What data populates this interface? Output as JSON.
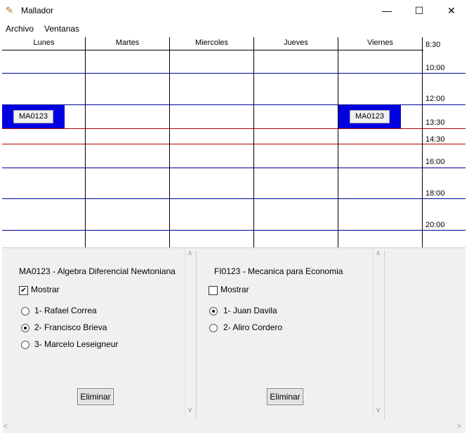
{
  "window": {
    "title": "Mallador",
    "icon": "compass-icon",
    "minimize": "—",
    "maximize": "☐",
    "close": "✕"
  },
  "menu": {
    "items": [
      "Archivo",
      "Ventanas"
    ]
  },
  "schedule": {
    "days": [
      "Lunes",
      "Martes",
      "Miercoles",
      "Jueves",
      "Viernes"
    ],
    "times": [
      "8:30",
      "10:00",
      "12:00",
      "13:30",
      "14:30",
      "16:00",
      "18:00",
      "20:00"
    ],
    "blocks": [
      {
        "day": "Lunes",
        "label": "MA0123"
      },
      {
        "day": "Viernes",
        "label": "MA0123"
      }
    ],
    "colors": {
      "block": "#0000e0",
      "line_blue": "#00009c",
      "line_red": "#b00000"
    }
  },
  "panels": [
    {
      "title": "MA0123 - Algebra Diferencial Newtoniana",
      "show_label": "Mostrar",
      "show_checked": true,
      "options": [
        "1- Rafael Correa",
        "2- Francisco Brieva",
        "3- Marcelo Leseigneur"
      ],
      "selected": 1,
      "delete_label": "Eliminar"
    },
    {
      "title": "FI0123 - Mecanica para Economia",
      "show_label": "Mostrar",
      "show_checked": false,
      "options": [
        "1- Juan Davila",
        "2- Aliro Cordero"
      ],
      "selected": 0,
      "delete_label": "Eliminar"
    }
  ]
}
